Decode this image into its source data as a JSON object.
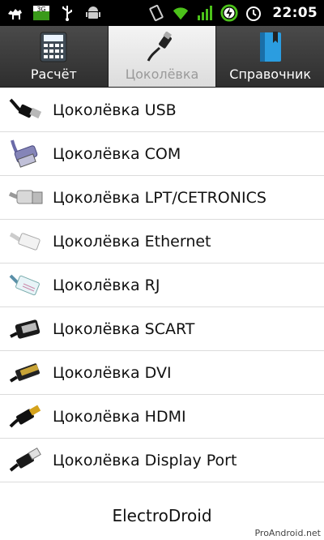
{
  "status_bar": {
    "network_label": "3G",
    "time": "22:05",
    "icons": [
      "camel-icon",
      "network-3g-icon",
      "usb-icon",
      "android-icon",
      "rotate-icon",
      "wifi-icon",
      "signal-icon",
      "battery-charging-icon",
      "alarm-icon"
    ]
  },
  "tabs": [
    {
      "label": "Расчёт",
      "icon": "calculator-icon",
      "active": false
    },
    {
      "label": "Цоколёвка",
      "icon": "usb-plug-icon",
      "active": true
    },
    {
      "label": "Справочник",
      "icon": "book-icon",
      "active": false
    }
  ],
  "items": [
    {
      "label": "Цоколёвка USB",
      "icon": "usb-connector-icon"
    },
    {
      "label": "Цоколёвка COM",
      "icon": "com-connector-icon"
    },
    {
      "label": "Цоколёвка LPT/CETRONICS",
      "icon": "lpt-connector-icon"
    },
    {
      "label": "Цоколёвка Ethernet",
      "icon": "ethernet-connector-icon"
    },
    {
      "label": "Цоколёвка RJ",
      "icon": "rj-connector-icon"
    },
    {
      "label": "Цоколёвка SCART",
      "icon": "scart-connector-icon"
    },
    {
      "label": "Цоколёвка DVI",
      "icon": "dvi-connector-icon"
    },
    {
      "label": "Цоколёвка HDMI",
      "icon": "hdmi-connector-icon"
    },
    {
      "label": "Цоколёвка Display Port",
      "icon": "displayport-connector-icon"
    }
  ],
  "footer": "ElectroDroid",
  "watermark": "ProAndroid.net"
}
